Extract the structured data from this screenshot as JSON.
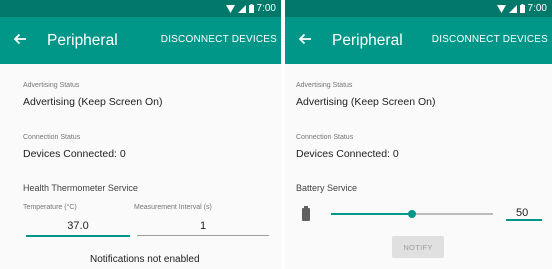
{
  "status_bar": {
    "time_left": "7:00",
    "time_right": "7:00"
  },
  "left": {
    "title": "Peripheral",
    "action": "DISCONNECT DEVICES",
    "advertising_label": "Advertising Status",
    "advertising_value": "Advertising (Keep Screen On)",
    "connection_label": "Connection Status",
    "connection_value": "Devices Connected: 0",
    "service_title": "Health Thermometer Service",
    "temperature_label": "Temperature (°C)",
    "temperature_value": "37.0",
    "interval_label": "Measurement Interval (s)",
    "interval_value": "1",
    "notifications_note": "Notifications not enabled"
  },
  "right": {
    "title": "Peripheral",
    "action": "DISCONNECT DEVICES",
    "advertising_label": "Advertising Status",
    "advertising_value": "Advertising (Keep Screen On)",
    "connection_label": "Connection Status",
    "connection_value": "Devices Connected: 0",
    "service_title": "Battery Service",
    "battery_level": 50,
    "battery_value": "50",
    "notify_label": "NOTIFY"
  },
  "colors": {
    "app_bar": "#009688",
    "status_bar": "#00796b",
    "accent": "#009688"
  },
  "icons": {
    "back": "arrow-back-icon",
    "wifi": "wifi-icon",
    "signal": "signal-icon",
    "battery_status": "battery-status-icon",
    "battery": "battery-icon"
  }
}
